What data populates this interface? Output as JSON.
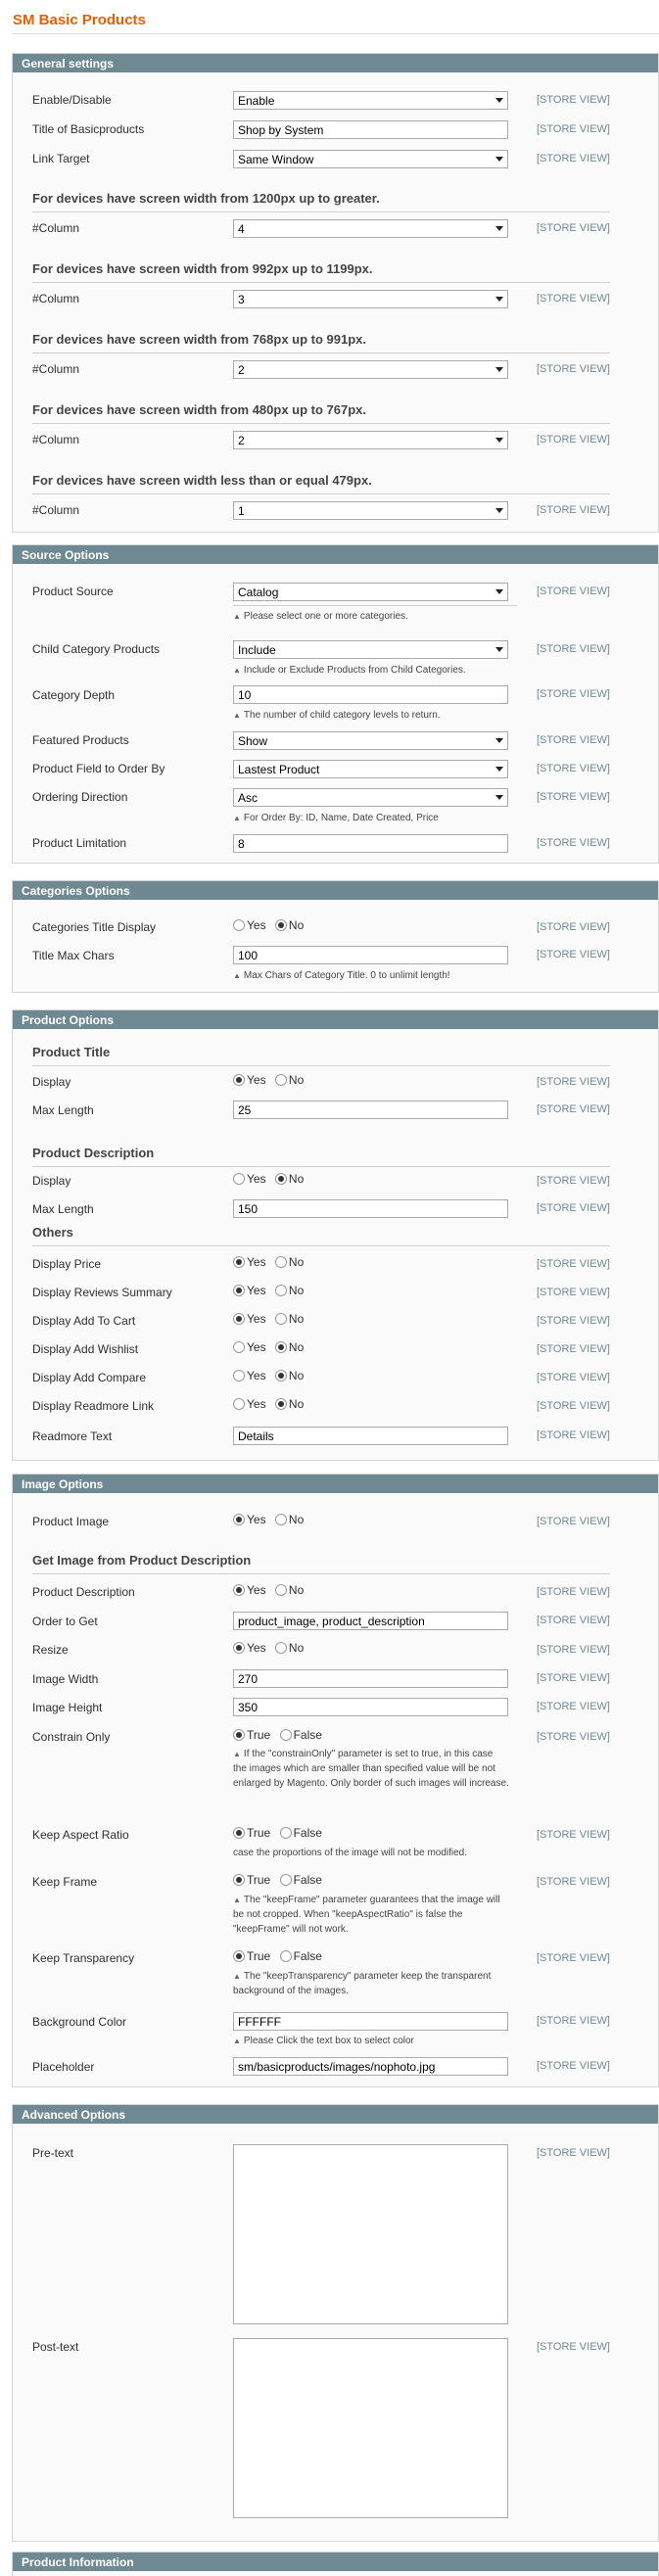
{
  "page": {
    "title": "SM Basic Products"
  },
  "scope_label": "[STORE VIEW]",
  "general": {
    "header": "General settings",
    "enable_label": "Enable/Disable",
    "enable_value": "Enable",
    "title_label": "Title of Basicproducts",
    "title_value": "Shop by System",
    "link_target_label": "Link Target",
    "link_target_value": "Same Window",
    "dev1": "For devices have screen width from 1200px up to greater.",
    "dev2": "For devices have screen width from 992px up to 1199px.",
    "dev3": "For devices have screen width from 768px up to 991px.",
    "dev4": "For devices have screen width from 480px up to 767px.",
    "dev5": "For devices have screen width less than or equal 479px.",
    "column_label": "#Column",
    "col1": "4",
    "col2": "3",
    "col3": "2",
    "col4": "2",
    "col5": "1"
  },
  "source": {
    "header": "Source Options",
    "product_source_label": "Product Source",
    "product_source_value": "Catalog",
    "product_source_note": "Please select one or more categories.",
    "child_label": "Child Category Products",
    "child_value": "Include",
    "child_note": "Include or Exclude Products from Child Categories.",
    "depth_label": "Category Depth",
    "depth_value": "10",
    "depth_note": "The number of child category levels to return.",
    "featured_label": "Featured Products",
    "featured_value": "Show",
    "order_by_label": "Product Field to Order By",
    "order_by_value": "Lastest Product",
    "direction_label": "Ordering Direction",
    "direction_value": "Asc",
    "direction_note": "For Order By: ID, Name, Date Created, Price",
    "limit_label": "Product Limitation",
    "limit_value": "8"
  },
  "categories": {
    "header": "Categories Options",
    "title_display_label": "Categories Title Display",
    "max_chars_label": "Title Max Chars",
    "max_chars_value": "100",
    "max_chars_note": "Max Chars of Category Title. 0 to unlimit length!"
  },
  "radio": {
    "yes": "Yes",
    "no": "No",
    "true": "True",
    "false": "False"
  },
  "product": {
    "header": "Product Options",
    "title_sub": "Product Title",
    "display_label": "Display",
    "max_length_label": "Max Length",
    "title_max_value": "25",
    "desc_sub": "Product Description",
    "desc_max_value": "150",
    "others_sub": "Others",
    "price_label": "Display Price",
    "reviews_label": "Display Reviews Summary",
    "cart_label": "Display Add To Cart",
    "wishlist_label": "Display Add Wishlist",
    "compare_label": "Display Add Compare",
    "readmore_label": "Display Readmore Link",
    "readmore_text_label": "Readmore Text",
    "readmore_text_value": "Details"
  },
  "image": {
    "header": "Image Options",
    "product_image_label": "Product Image",
    "get_sub": "Get Image from Product Description",
    "desc_label": "Product Description",
    "order_label": "Order to Get",
    "order_value": "product_image, product_description",
    "resize_label": "Resize",
    "width_label": "Image Width",
    "width_value": "270",
    "height_label": "Image Height",
    "height_value": "350",
    "constrain_label": "Constrain Only",
    "constrain_note": "If the \"constrainOnly\" parameter is set to true, in this case the images which are smaller than specified value will be not enlarged by Magento. Only border of such images will increase.",
    "aspect_label": "Keep Aspect Ratio",
    "aspect_note": "case the proportions of the image will not be modified.",
    "frame_label": "Keep Frame",
    "frame_note": "The \"keepFrame\" parameter guarantees that the image will be not cropped. When \"keepAspectRatio\" is false the \"keepFrame\" will not work.",
    "transparency_label": "Keep Transparency",
    "transparency_note": "The \"keepTransparency\" parameter keep the transparent background of the images.",
    "bg_label": "Background Color",
    "bg_value": "FFFFFF",
    "bg_note": "Please Click the text box to select color",
    "placeholder_label": "Placeholder",
    "placeholder_value": "sm/basicproducts/images/nophoto.jpg"
  },
  "advanced": {
    "header": "Advanced Options",
    "pre_label": "Pre-text",
    "post_label": "Post-text"
  },
  "info": {
    "header": "Product Information"
  }
}
